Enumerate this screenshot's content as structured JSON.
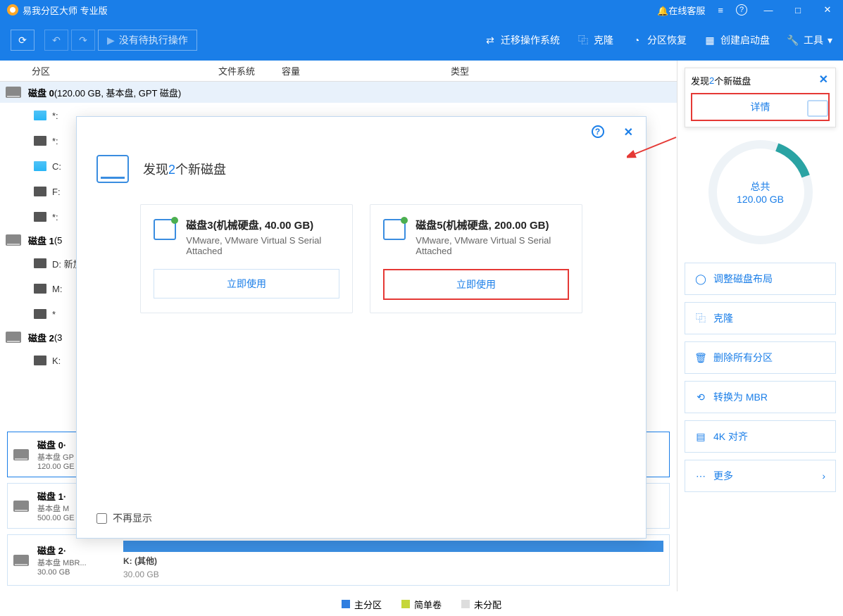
{
  "titlebar": {
    "title": "易我分区大师 专业版",
    "online_service": "在线客服",
    "menu_icon": "≡",
    "help_icon": "?",
    "min_icon": "—",
    "max_icon": "□",
    "close_icon": "✕"
  },
  "toolbar": {
    "refresh_icon": "⟳",
    "undo_icon": "↶",
    "redo_icon": "↷",
    "play_icon": "▶",
    "pending": "没有待执行操作",
    "migrate_os": "迁移操作系统",
    "clone": "克隆",
    "recover": "分区恢复",
    "create_boot": "创建启动盘",
    "tools": "工具",
    "tools_chev": "▾"
  },
  "table_headers": {
    "partition": "分区",
    "filesystem": "文件系统",
    "capacity": "容量",
    "type": "类型"
  },
  "disk0": {
    "header_label": "磁盘 0",
    "header_detail": " (120.00 GB, 基本盘, GPT 磁盘)",
    "parts": [
      "*:",
      "*:",
      "C:",
      "F:",
      "*:"
    ]
  },
  "disk1": {
    "header_label": "磁盘 1",
    "header_detail": " (5",
    "parts": [
      "D: 新加",
      "M:",
      "*"
    ]
  },
  "disk2": {
    "header_label": "磁盘 2",
    "header_detail": " (3",
    "parts": [
      "K:"
    ]
  },
  "cards": [
    {
      "name": "磁盘 0·",
      "sub": "基本盘 GP",
      "size": "120.00 GE"
    },
    {
      "name": "磁盘 1·",
      "sub": "基本盘 M",
      "size": "500.00 GE"
    },
    {
      "name": "磁盘 2·",
      "sub": "基本盘 MBR...",
      "size": "30.00 GB",
      "label": "K: (其他)",
      "label2": "30.00 GB"
    }
  ],
  "legend": {
    "primary": "主分区",
    "simple": "简单卷",
    "unalloc": "未分配"
  },
  "rp": {
    "notify_prefix": "发现",
    "notify_count": "2",
    "notify_suffix": "个新磁盘",
    "detail_btn": "详情",
    "total_label": "总共",
    "total_value": "120.00 GB",
    "actions": {
      "adjust": "调整磁盘布局",
      "clone": "克隆",
      "delete_all": "删除所有分区",
      "convert": "转换为 MBR",
      "align": "4K 对齐",
      "more": "更多",
      "more_chev": "›"
    }
  },
  "modal": {
    "help_icon": "?",
    "close_icon": "✕",
    "title_prefix": "发现",
    "title_count": "2",
    "title_suffix": "个新磁盘",
    "disk3": {
      "name": "磁盘3(机械硬盘, 40.00 GB)",
      "sub": "VMware,  VMware Virtual S Serial Attached",
      "btn": "立即使用"
    },
    "disk5": {
      "name": "磁盘5(机械硬盘, 200.00 GB)",
      "sub": "VMware,  VMware Virtual S Serial Attached",
      "btn": "立即使用"
    },
    "dont_show": "不再显示"
  }
}
